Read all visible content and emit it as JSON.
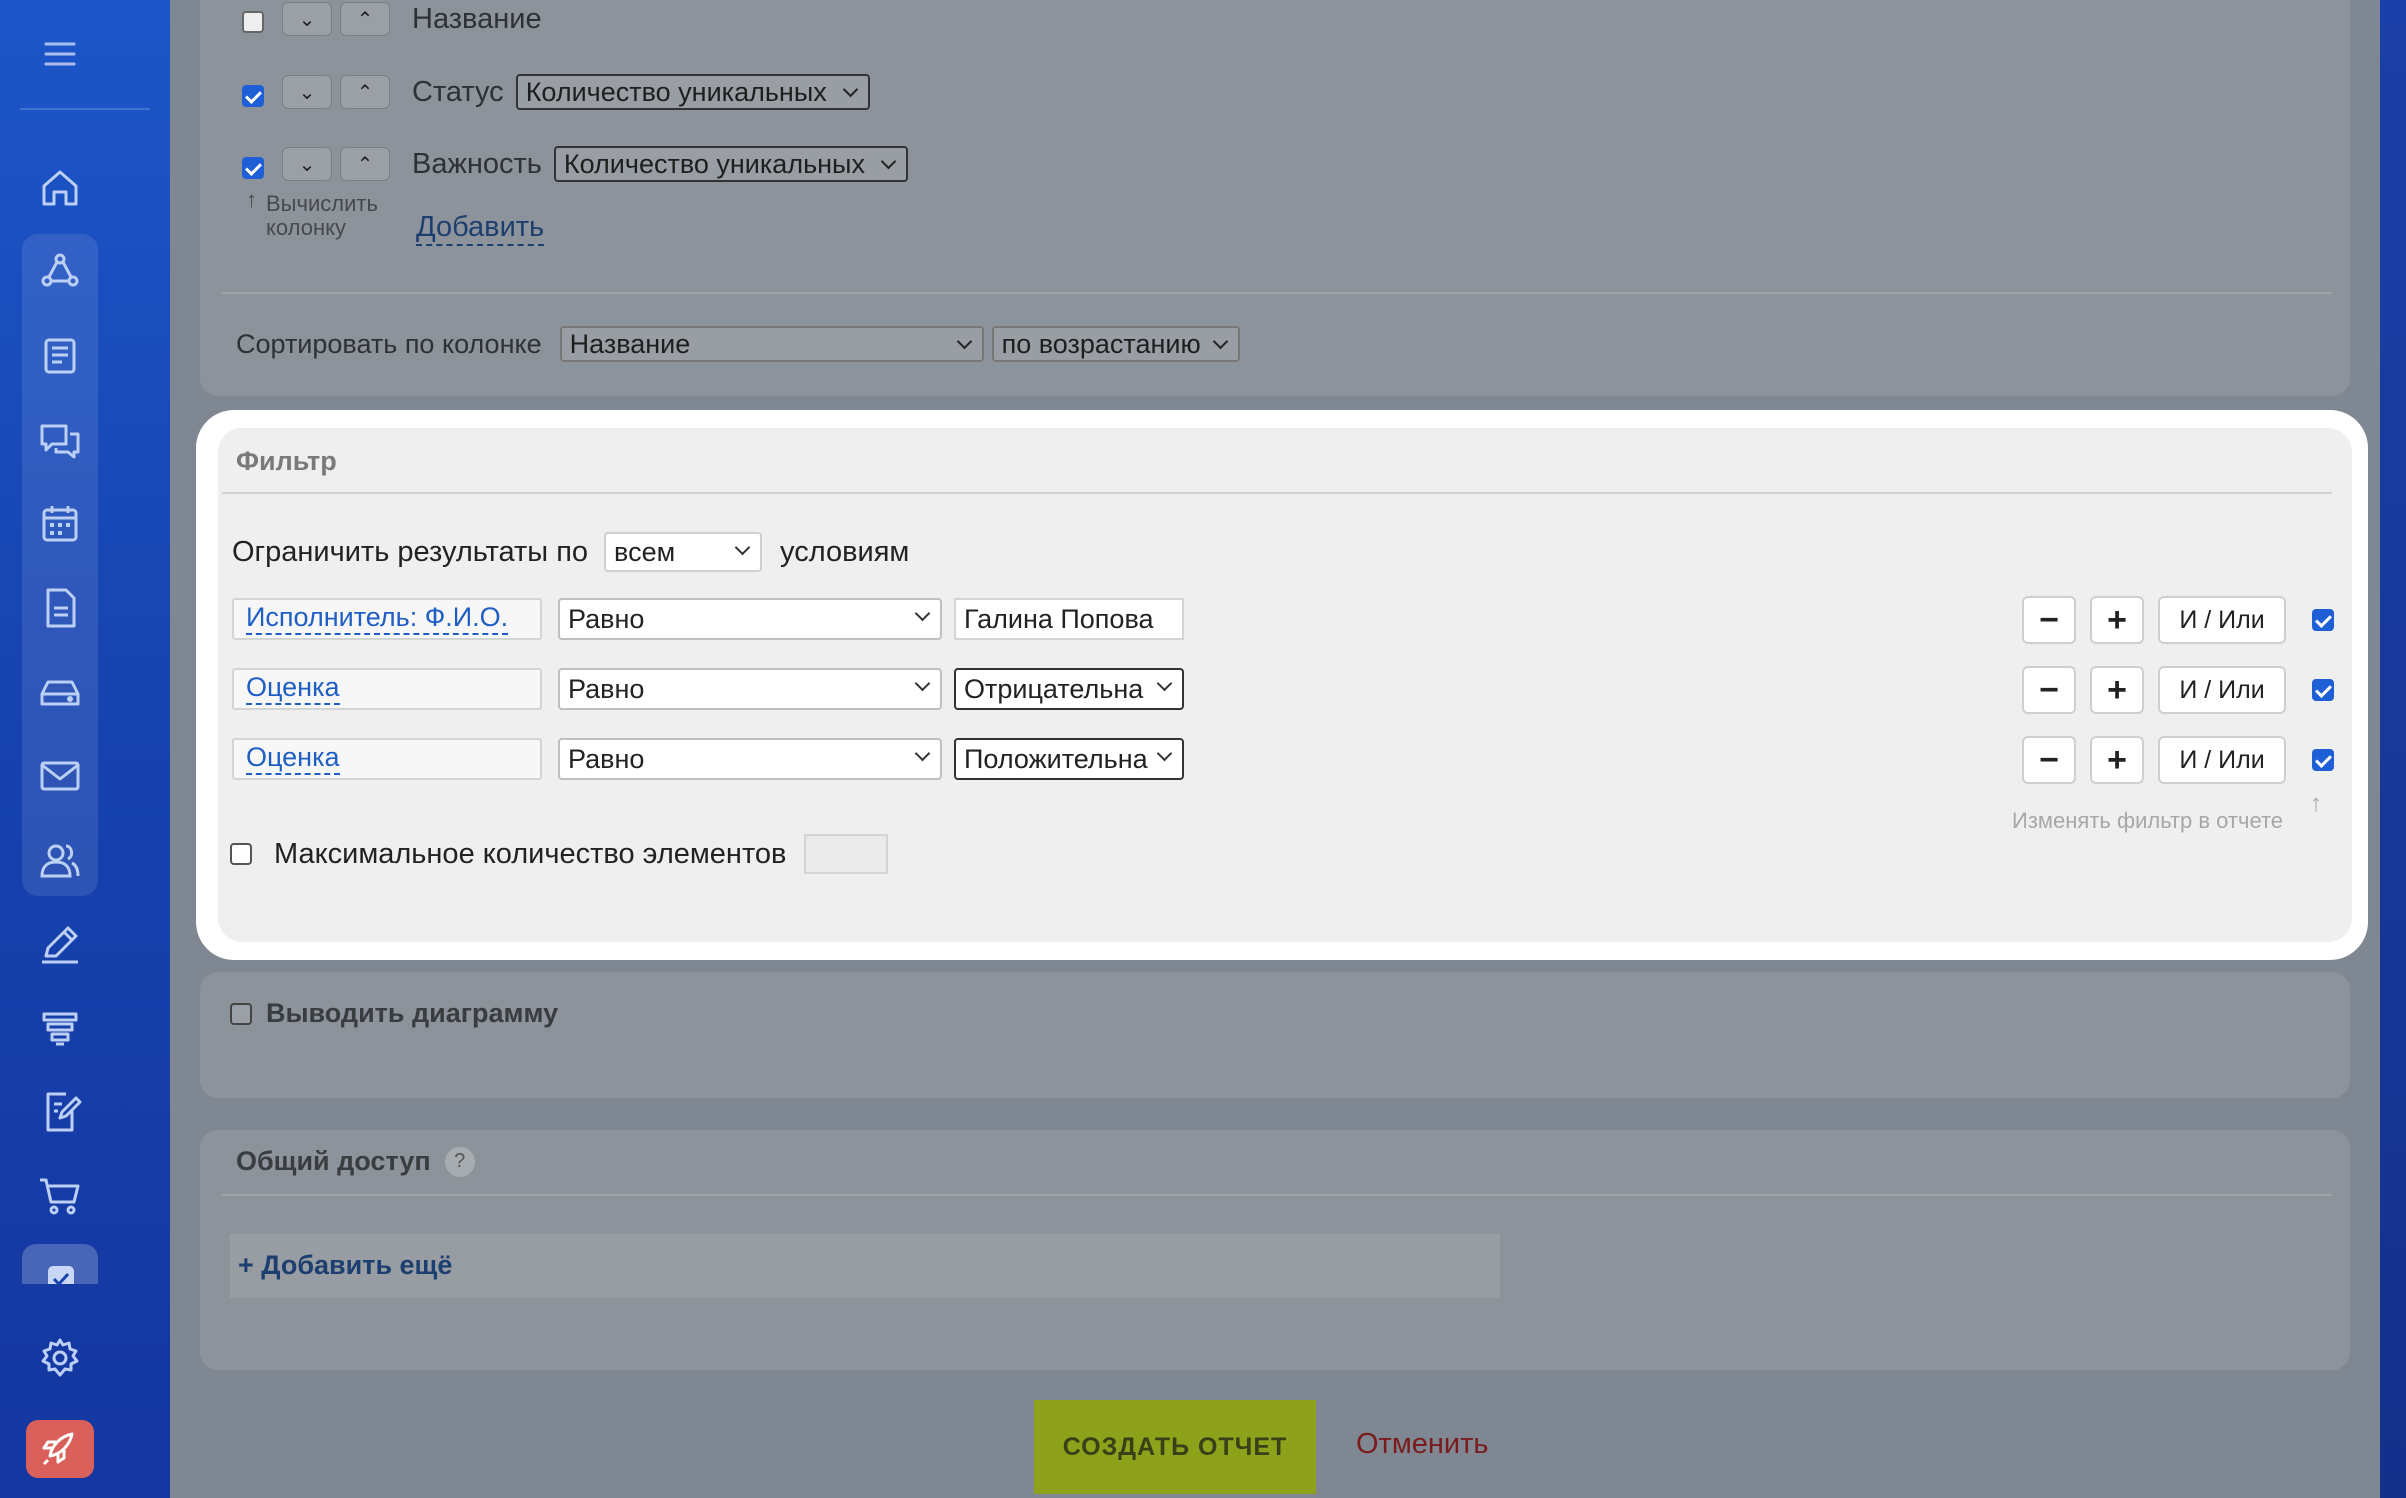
{
  "sidebar": {
    "icons": [
      "menu-icon",
      "home-icon",
      "workflow-icon",
      "document-list-icon",
      "chat-icon",
      "calendar-icon",
      "file-icon",
      "inbox-icon",
      "mail-icon",
      "users-icon",
      "pen-icon",
      "filter-stack-icon",
      "edit-doc-icon",
      "cart-icon",
      "check-icon",
      "settings-icon",
      "rocket-icon"
    ]
  },
  "columns": {
    "rows": [
      {
        "label": "Название",
        "checked": false,
        "calc": ""
      },
      {
        "label": "Статус",
        "checked": true,
        "calc": "Количество уникальных"
      },
      {
        "label": "Важность",
        "checked": true,
        "calc": "Количество уникальных"
      }
    ],
    "compute_label_line1": "Вычислить",
    "compute_label_line2": "колонку",
    "add_link": "Добавить"
  },
  "sort": {
    "label": "Сортировать по колонке",
    "column": "Название",
    "order": "по возрастанию"
  },
  "filter": {
    "title": "Фильтр",
    "limit_prefix": "Ограничить результаты по",
    "limit_mode": "всем",
    "limit_suffix": "условиям",
    "conditions": [
      {
        "field": "Исполнитель: Ф.И.О.",
        "op": "Равно",
        "value": "Галина Попова",
        "value_type": "text",
        "checked": true
      },
      {
        "field": "Оценка",
        "op": "Равно",
        "value": "Отрицательна",
        "value_type": "select",
        "checked": true
      },
      {
        "field": "Оценка",
        "op": "Равно",
        "value": "Положительна",
        "value_type": "select",
        "checked": true
      }
    ],
    "minus": "−",
    "plus": "+",
    "and_or": "И / Или",
    "change_in_report": "Изменять фильтр в отчете",
    "max_items_label": "Максимальное количество элементов",
    "max_items_value": ""
  },
  "diagram": {
    "label": "Выводить диаграмму"
  },
  "sharing": {
    "title": "Общий доступ",
    "help": "?",
    "add_more": "+ Добавить ещё"
  },
  "actions": {
    "create": "СОЗДАТЬ ОТЧЕТ",
    "cancel": "Отменить"
  }
}
